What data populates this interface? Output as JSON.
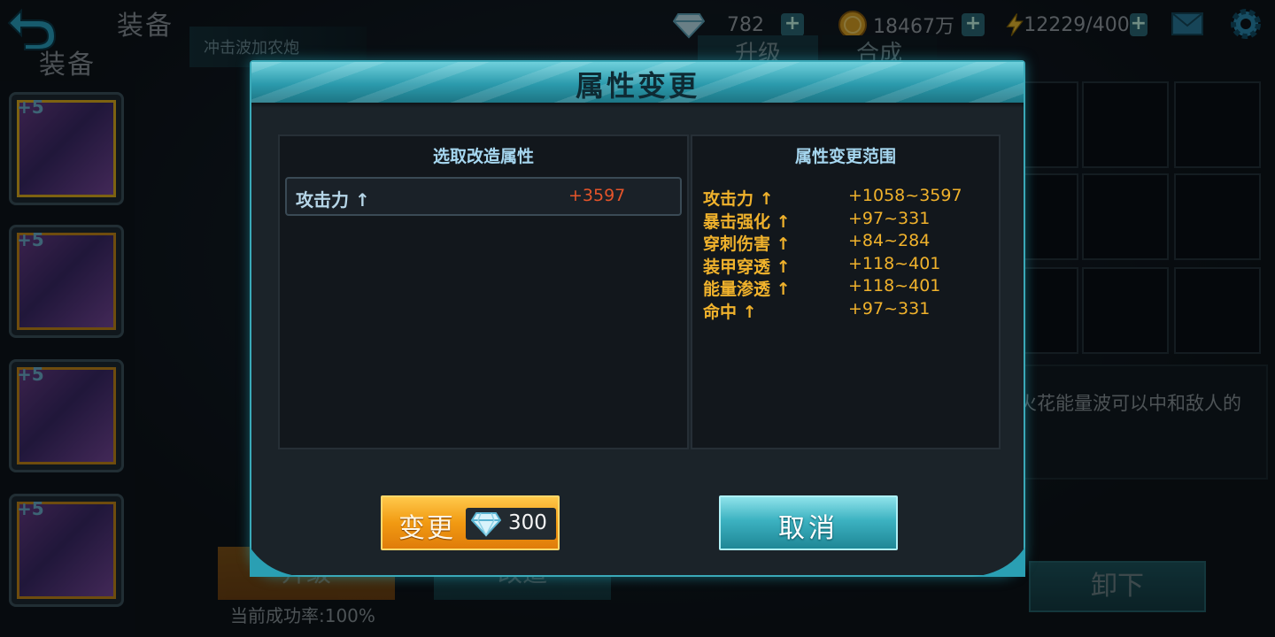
{
  "header": {
    "page_title": "装备",
    "section_title": "装备"
  },
  "resources": {
    "gems": "782",
    "gold": "18467万",
    "energy": "12229/400"
  },
  "weapon_tab": {
    "label": "冲击波加农炮"
  },
  "tabs": {
    "upgrade": "升级",
    "compose": "合成"
  },
  "equipment": [
    {
      "level": "+5"
    },
    {
      "level": "+5"
    },
    {
      "level": "+5"
    },
    {
      "level": "+5"
    }
  ],
  "description_snippet": "火花能量波可以中和敌人的",
  "bottom": {
    "unequip": "卸下",
    "upgrade": "升级",
    "modify": "改造",
    "success_rate": "当前成功率:100%"
  },
  "dialog": {
    "title": "属性变更",
    "left_panel": {
      "header": "选取改造属性",
      "selected": {
        "name": "攻击力 ↑",
        "value": "+3597"
      }
    },
    "right_panel": {
      "header": "属性变更范围",
      "ranges": [
        {
          "name": "攻击力 ↑",
          "range": "+1058~3597"
        },
        {
          "name": "暴击强化 ↑",
          "range": "+97~331"
        },
        {
          "name": "穿刺伤害 ↑",
          "range": "+84~284"
        },
        {
          "name": "装甲穿透 ↑",
          "range": "+118~401"
        },
        {
          "name": "能量渗透 ↑",
          "range": "+118~401"
        },
        {
          "name": "命中 ↑",
          "range": "+97~331"
        }
      ]
    },
    "change_button": {
      "label": "变更",
      "cost": "300",
      "cost_icon": "diamond-icon"
    },
    "cancel_button": {
      "label": "取消"
    }
  },
  "colors": {
    "accent_cyan": "#3aa9b8",
    "range_text": "#f0b22c",
    "selected_value": "#e4542a",
    "change_button": "#f19a12"
  }
}
